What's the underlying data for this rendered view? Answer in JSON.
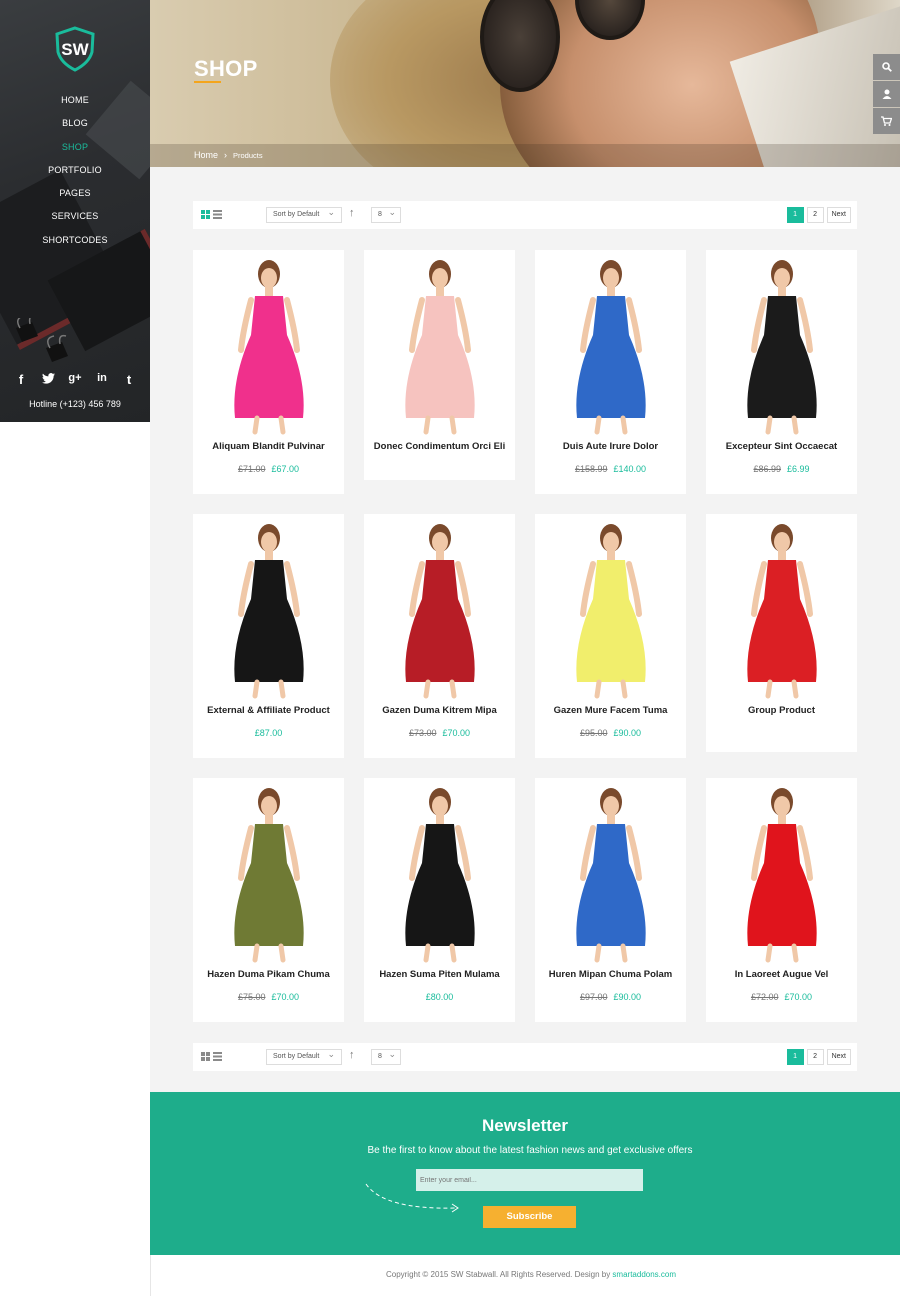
{
  "sidebar": {
    "logo_text": "SW",
    "nav": [
      "HOME",
      "BLOG",
      "SHOP",
      "PORTFOLIO",
      "PAGES",
      "SERVICES",
      "SHORTCODES"
    ],
    "active": "SHOP",
    "social_icons": [
      "facebook-icon",
      "twitter-icon",
      "google-plus-icon",
      "linkedin-icon",
      "tumblr-icon"
    ],
    "hotline": "Hotline (+123) 456 789"
  },
  "hero": {
    "title": "SHOP",
    "breadcrumb_home": "Home",
    "breadcrumb_sep": "›",
    "breadcrumb_current": "Products"
  },
  "side_tools": [
    "search-icon",
    "user-icon",
    "cart-icon"
  ],
  "toolbar": {
    "sort": "Sort by Default",
    "sort_dir": "↑",
    "per_page": "8",
    "pages": [
      "1",
      "2"
    ],
    "current_page": "1",
    "next": "Next"
  },
  "products": [
    {
      "name": "Aliquam Blandit Pulvinar",
      "old": "£71.00",
      "new": "£67.00"
    },
    {
      "name": "Donec Condimentum Orci Eli",
      "old": "",
      "new": ""
    },
    {
      "name": "Duis Aute Irure Dolor",
      "old": "£158.99",
      "new": "£140.00"
    },
    {
      "name": "Excepteur Sint Occaecat",
      "old": "£86.99",
      "new": "£6.99"
    },
    {
      "name": "External & Affiliate Product",
      "old": "",
      "new": "£87.00"
    },
    {
      "name": "Gazen Duma Kitrem Mipa",
      "old": "£73.00",
      "new": "£70.00"
    },
    {
      "name": "Gazen Mure Facem Tuma",
      "old": "£95.00",
      "new": "£90.00"
    },
    {
      "name": "Group Product",
      "old": "",
      "new": ""
    },
    {
      "name": "Hazen Duma Pikam Chuma",
      "old": "£75.00",
      "new": "£70.00"
    },
    {
      "name": "Hazen Suma Piten Mulama",
      "old": "",
      "new": "£80.00"
    },
    {
      "name": "Huren Mipan Chuma Polam",
      "old": "£97.00",
      "new": "£90.00"
    },
    {
      "name": "In Laoreet Augue Vel",
      "old": "£72.00",
      "new": "£70.00"
    }
  ],
  "product_colors": [
    "#f0308c",
    "#f6c3bf",
    "#2f69c8",
    "#1b1b1b",
    "#161616",
    "#b71d26",
    "#f1ee6c",
    "#db1f24",
    "#6f7a34",
    "#161616",
    "#2f69c8",
    "#e0141c"
  ],
  "newsletter": {
    "title": "Newsletter",
    "subtitle": "Be the first to know about the latest fashion news and get exclusive offers",
    "placeholder": "Enter your email...",
    "button": "Subscribe"
  },
  "footer": {
    "text": "Copyright © 2015 SW Stabwall. All Rights Reserved. Design by ",
    "brand": "smartaddons.com"
  },
  "colors": {
    "accent": "#1abc9c",
    "newsletter_bg": "#1ead8b",
    "button": "#f6b030",
    "underline": "#f4a51c"
  }
}
